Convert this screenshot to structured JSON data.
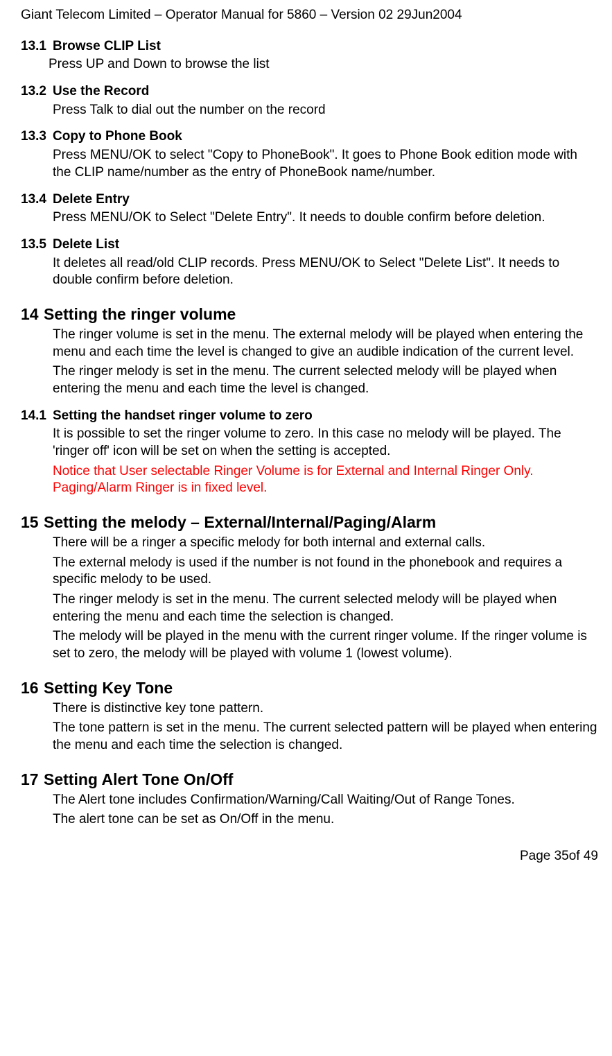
{
  "header": "Giant Telecom Limited – Operator Manual for 5860 – Version 02 29Jun2004",
  "s13_1_num": "13.1",
  "s13_1_title": "Browse CLIP List",
  "s13_1_body": "Press UP and Down to browse the list",
  "s13_2_num": "13.2",
  "s13_2_title": "Use the Record",
  "s13_2_body": "Press Talk to dial out the number on the record",
  "s13_3_num": "13.3",
  "s13_3_title": "Copy to Phone Book",
  "s13_3_body": "Press MENU/OK to select \"Copy to PhoneBook\". It goes to Phone Book edition mode with the CLIP name/number as the entry of PhoneBook name/number.",
  "s13_4_num": "13.4",
  "s13_4_title": "Delete Entry",
  "s13_4_body": "Press MENU/OK to Select \"Delete Entry\". It needs to double confirm before deletion.",
  "s13_5_num": "13.5",
  "s13_5_title": "Delete List",
  "s13_5_body": "It deletes all read/old CLIP records. Press MENU/OK to Select \"Delete List\". It needs to double confirm before deletion.",
  "s14_num": "14",
  "s14_title": "Setting the ringer volume",
  "s14_body1": "The ringer volume is set in the menu. The external melody will be played when entering the menu and each time the level is changed to give an audible indication of the current level.",
  "s14_body2": "The ringer melody is set in the menu. The current selected melody will be played when entering the menu and each time the level is changed.",
  "s14_1_num": "14.1",
  "s14_1_title": "Setting the handset ringer volume to zero",
  "s14_1_body": "It is possible to set the ringer volume to zero. In this case no melody will be played. The 'ringer off' icon will be set on when the setting is accepted.",
  "s14_1_notice": "Notice that User selectable Ringer Volume is for External and Internal Ringer Only. Paging/Alarm Ringer is in fixed level.",
  "s15_num": "15",
  "s15_title": "Setting the melody – External/Internal/Paging/Alarm",
  "s15_body1": "There will be a ringer a specific melody for both internal and external calls.",
  "s15_body2": "The external melody is used if the number is not found in the phonebook and requires a specific melody to be used.",
  "s15_body3": "The ringer melody is set in the menu. The current selected melody will be played when entering the menu and each time the selection is changed.",
  "s15_body4": "The melody will be played in the menu with the current ringer volume. If the ringer volume is set to zero, the melody will be played with volume 1 (lowest volume).",
  "s16_num": "16",
  "s16_title": "Setting Key Tone",
  "s16_body1": "There is distinctive key tone pattern.",
  "s16_body2": "The tone pattern is set in the menu. The current selected pattern will be played when entering the menu and each time the selection is changed.",
  "s17_num": "17",
  "s17_title": "Setting Alert Tone On/Off",
  "s17_body1": "The Alert tone includes Confirmation/Warning/Call Waiting/Out of Range Tones.",
  "s17_body2": "The alert tone can be set as On/Off in the menu.",
  "footer": "Page 35of 49"
}
